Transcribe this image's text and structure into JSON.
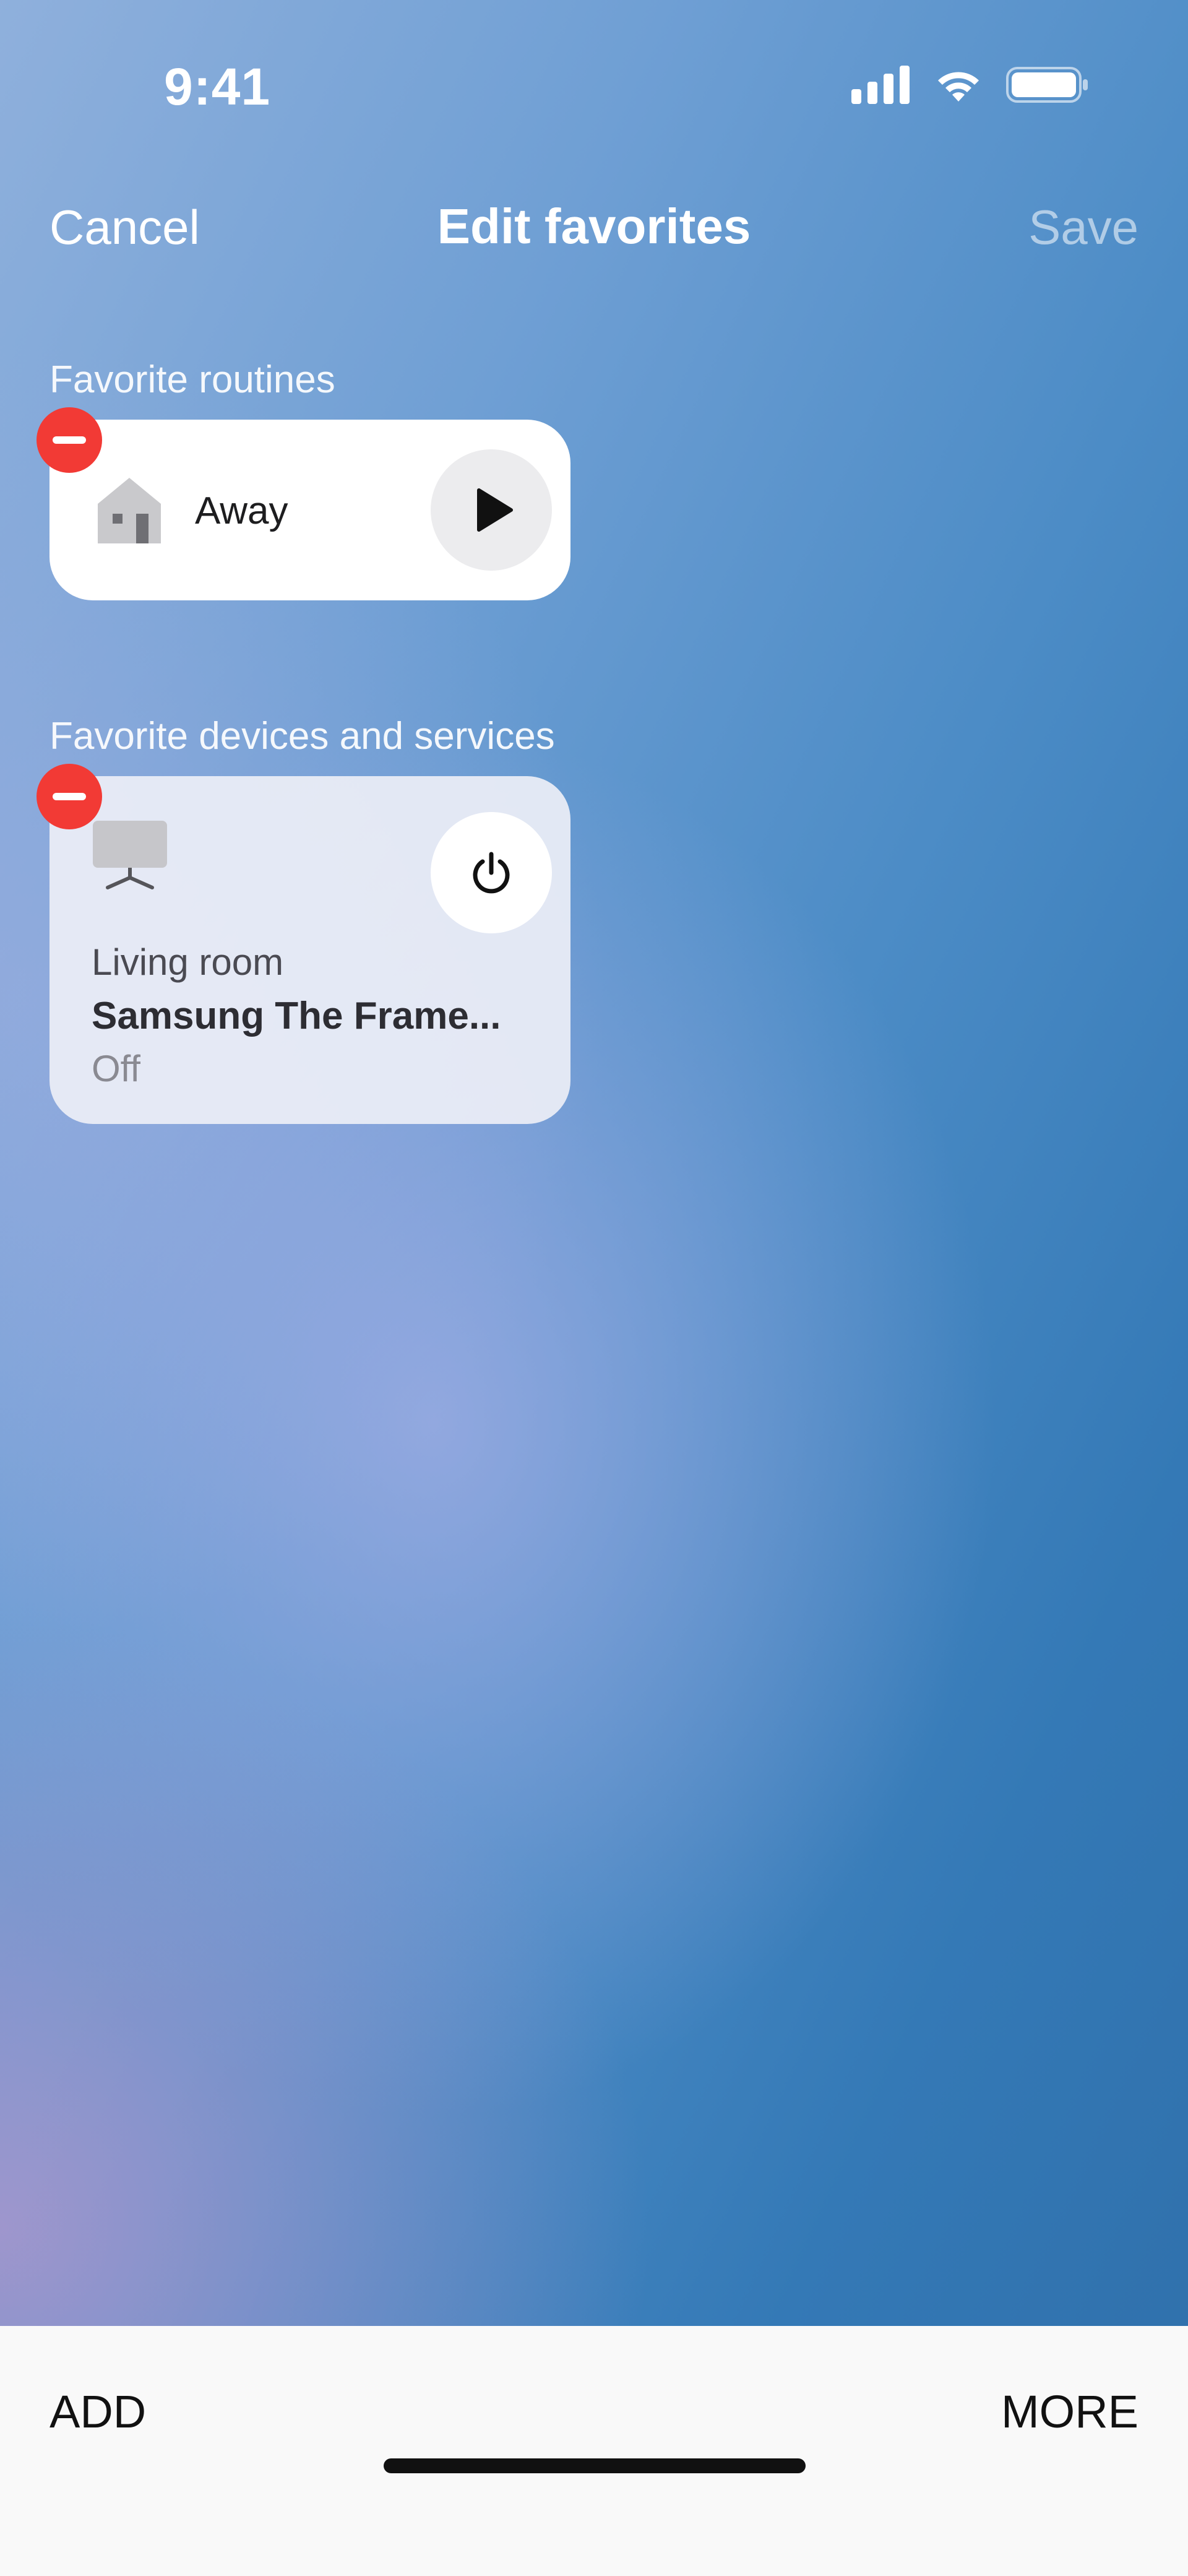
{
  "status_bar": {
    "time": "9:41",
    "icons": [
      "cellular-signal-icon",
      "wifi-icon",
      "battery-icon"
    ]
  },
  "nav": {
    "cancel_label": "Cancel",
    "title": "Edit favorites",
    "save_label": "Save"
  },
  "sections": {
    "routines_label": "Favorite routines",
    "devices_label": "Favorite devices and services"
  },
  "routines": [
    {
      "name": "Away",
      "icon": "house-icon",
      "action_icon": "play-icon"
    }
  ],
  "devices": [
    {
      "room": "Living room",
      "name": "Samsung The Frame...",
      "status": "Off",
      "icon": "tv-icon",
      "action_icon": "power-icon"
    }
  ],
  "toolbar": {
    "add_label": "ADD",
    "more_label": "MORE"
  },
  "colors": {
    "remove_badge": "#f23a35",
    "routine_card": "#ffffff",
    "device_card": "#eceef6",
    "bottom_bar": "#f9f9f9",
    "save_disabled": "rgba(255,255,255,0.55)"
  }
}
